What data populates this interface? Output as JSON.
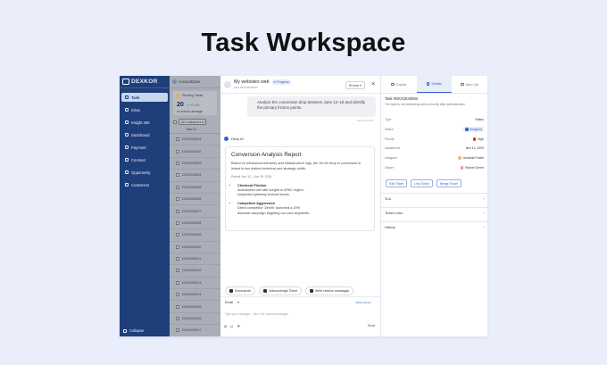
{
  "hero_title": "Task Workspace",
  "sidebar": {
    "brand": "DEXKOR",
    "items": [
      {
        "label": "Task",
        "active": true
      },
      {
        "label": "Inbox"
      },
      {
        "label": "Insight 360"
      },
      {
        "label": "Dashboard"
      },
      {
        "label": "Payment"
      },
      {
        "label": "Contract"
      },
      {
        "label": "Opportunity"
      },
      {
        "label": "Customers"
      }
    ],
    "collapse": "Collapse"
  },
  "tasklist": {
    "account": "AccountCare",
    "pending_label": "Pending Tasks",
    "pending_count": "20",
    "pending_change": "↗ +1.4%",
    "pending_note": "vs team's average",
    "filter": "All Customers",
    "column": "Task ID",
    "rows": [
      "DKX2025001",
      "DKX2025002",
      "DKX2025003",
      "DKX2025004",
      "DKX2025005",
      "DKX2025006",
      "DKX2025007",
      "DKX2025008",
      "DKX2025009",
      "DKX2025010",
      "DKX2025011",
      "DKX2025012",
      "DKX2025013",
      "DKX2025014",
      "DKX2025015",
      "DKX2025016",
      "DKX2025017",
      "DKX2025018",
      "DKX2025019"
    ]
  },
  "chat": {
    "title": "My websites web",
    "subtitle": "Task #DKX2025083",
    "status": "In Progress",
    "browse": "Browse ▾",
    "user_message": "Analyze the conversion drop between June 12–19 and identify the primary friction points.",
    "user_time": "Sent 10:24 AM",
    "bot_name": "Dexy AI",
    "report_title": "Conversion Analysis Report",
    "report_intro": "Based on behavioral telemetry and infrastructure logs, the 18.4% drop in conversion is linked to two distinct technical and strategic shifts:",
    "report_period": "Period: Jun 12 – Jun 19, 2024",
    "findings": [
      {
        "title": "Checkout Friction",
        "lines": [
          "Abandoned cart rate surged in APAC region;",
          "suspected gateway timeout issues."
        ]
      },
      {
        "title": "Competitor Aggression",
        "lines": [
          "Direct competitor 'Zenith' launched a 20%",
          "discount campaign targeting our core segments."
        ]
      }
    ],
    "quick_actions": [
      "Summarize",
      "Acknowledge Ticket",
      "Write resolve messages"
    ],
    "channel": "Email",
    "shortcut_label": "Show Others",
    "composer_hint": "Type your message... Use # for canned messages",
    "send": "Send"
  },
  "details": {
    "tabs": [
      "Copilot",
      "Details",
      "Auto QA"
    ],
    "task_id": "Task #DKX2025083",
    "description": "The login is not redirecting users correctly after authentication.",
    "fields": [
      {
        "key": "Type",
        "value": "Status"
      },
      {
        "key": "Status",
        "value": "Assigned"
      },
      {
        "key": "Priority",
        "value": "High"
      },
      {
        "key": "Updated At",
        "value": "Nov 14, 2025"
      },
      {
        "key": "Assignee",
        "value": "Amanda Foster"
      },
      {
        "key": "Owner",
        "value": "Rachel Green"
      }
    ],
    "actions": [
      "Edit Ticket",
      "Link Ticket",
      "Merge Ticket"
    ],
    "sections": [
      "SLA",
      "Ticket Links",
      "History"
    ]
  },
  "colors": {
    "sidebar": "#1f3f7a",
    "accent": "#3a62c8",
    "priority_high": "#c0392b"
  }
}
